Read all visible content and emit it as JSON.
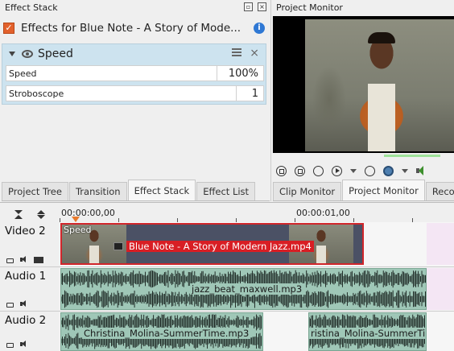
{
  "effect_stack": {
    "dock_title": "Effect Stack",
    "header_label": "Effects for Blue Note - A Story of Mode...",
    "effect": {
      "name": "Speed",
      "params": [
        {
          "label": "Speed",
          "value": "100%"
        },
        {
          "label": "Stroboscope",
          "value": "1"
        }
      ]
    }
  },
  "left_tabs": [
    {
      "label": "Project Tree",
      "active": false
    },
    {
      "label": "Transition",
      "active": false
    },
    {
      "label": "Effect Stack",
      "active": true
    },
    {
      "label": "Effect List",
      "active": false
    }
  ],
  "monitor": {
    "dock_title": "Project Monitor",
    "tabs": [
      {
        "label": "Clip Monitor",
        "active": false
      },
      {
        "label": "Project Monitor",
        "active": true
      },
      {
        "label": "Record",
        "active": false
      }
    ]
  },
  "timeline": {
    "ruler": [
      "00:00:00,00",
      "00:00:01,00"
    ],
    "tracks": [
      {
        "name": "Video 2",
        "type": "video"
      },
      {
        "name": "Audio 1",
        "type": "audio"
      },
      {
        "name": "Audio 2",
        "type": "audio"
      }
    ],
    "video_clip": {
      "effect_label": "Speed",
      "name": "Blue Note - A Story of Modern Jazz.mp4"
    },
    "audio1_clip": {
      "name": "jazz_beat_maxwell.mp3"
    },
    "audio2_clips": [
      {
        "name": "Christina_Molina-SummerTime.mp3"
      },
      {
        "name": "ristina_Molina-SummerTime."
      }
    ]
  },
  "colors": {
    "clip_selected_border": "#d1262b",
    "audio_clip": "#9fc7b7",
    "effect_box": "#cde3ef",
    "accent_checkbox": "#e2612c"
  }
}
